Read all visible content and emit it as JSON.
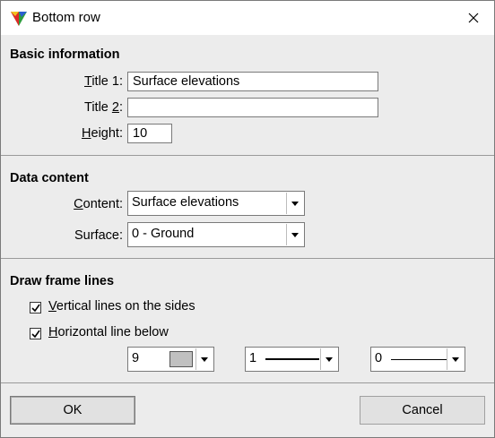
{
  "window": {
    "title": "Bottom row"
  },
  "basic_information": {
    "heading": "Basic information",
    "title1": {
      "label_mnemonic": "T",
      "label_rest": "itle 1:",
      "value": "Surface elevations"
    },
    "title2": {
      "label_pre": "Title ",
      "label_mnemonic": "2",
      "label_post": ":",
      "value": ""
    },
    "height": {
      "label_mnemonic": "H",
      "label_rest": "eight:",
      "value": "10"
    }
  },
  "data_content": {
    "heading": "Data content",
    "content": {
      "label_mnemonic": "C",
      "label_rest": "ontent:",
      "selected": "Surface elevations"
    },
    "surface": {
      "label": "Surface:",
      "selected": "0 - Ground"
    }
  },
  "draw_frame_lines": {
    "heading": "Draw frame lines",
    "vertical": {
      "checked": true,
      "label_mnemonic": "V",
      "label_rest": "ertical lines on the sides"
    },
    "horizontal": {
      "checked": true,
      "label_mnemonic": "H",
      "label_rest": "orizontal line below"
    },
    "color": {
      "selected": "9",
      "swatch_color": "#c0c0c0"
    },
    "line_width": {
      "selected": "1"
    },
    "line_style": {
      "selected": "0"
    }
  },
  "buttons": {
    "ok": "OK",
    "cancel": "Cancel"
  },
  "icons": {
    "app": "app-logo-icon",
    "close": "close-icon",
    "dropdown": "chevron-down-icon",
    "check": "checkmark-icon"
  }
}
